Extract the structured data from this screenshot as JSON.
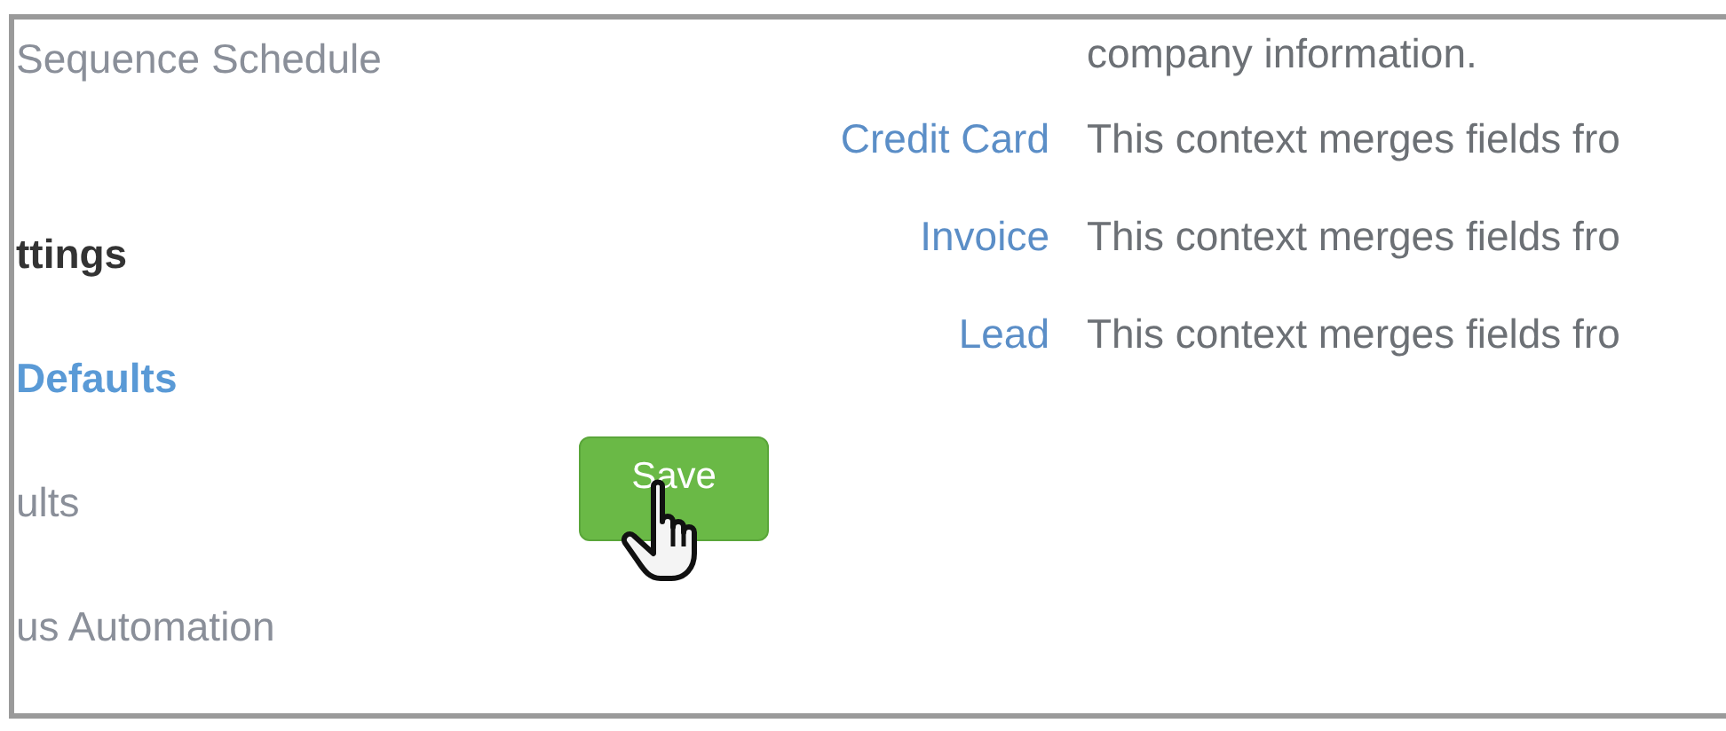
{
  "sidebar": {
    "items": [
      {
        "kind": "link",
        "label": "Sequence Schedule",
        "selected": false
      },
      {
        "kind": "heading",
        "label": "ttings"
      },
      {
        "kind": "link",
        "label": "Defaults",
        "selected": true
      },
      {
        "kind": "link",
        "label": "ults",
        "selected": false
      },
      {
        "kind": "link",
        "label": "us Automation",
        "selected": false
      }
    ]
  },
  "contexts": [
    {
      "description": "company information."
    },
    {
      "name": "Credit Card",
      "description": "This context merges fields fro"
    },
    {
      "name": "Invoice",
      "description": "This context merges fields fro"
    },
    {
      "name": "Lead",
      "description": "This context merges fields fro"
    }
  ],
  "save_button": {
    "label": "Save"
  }
}
